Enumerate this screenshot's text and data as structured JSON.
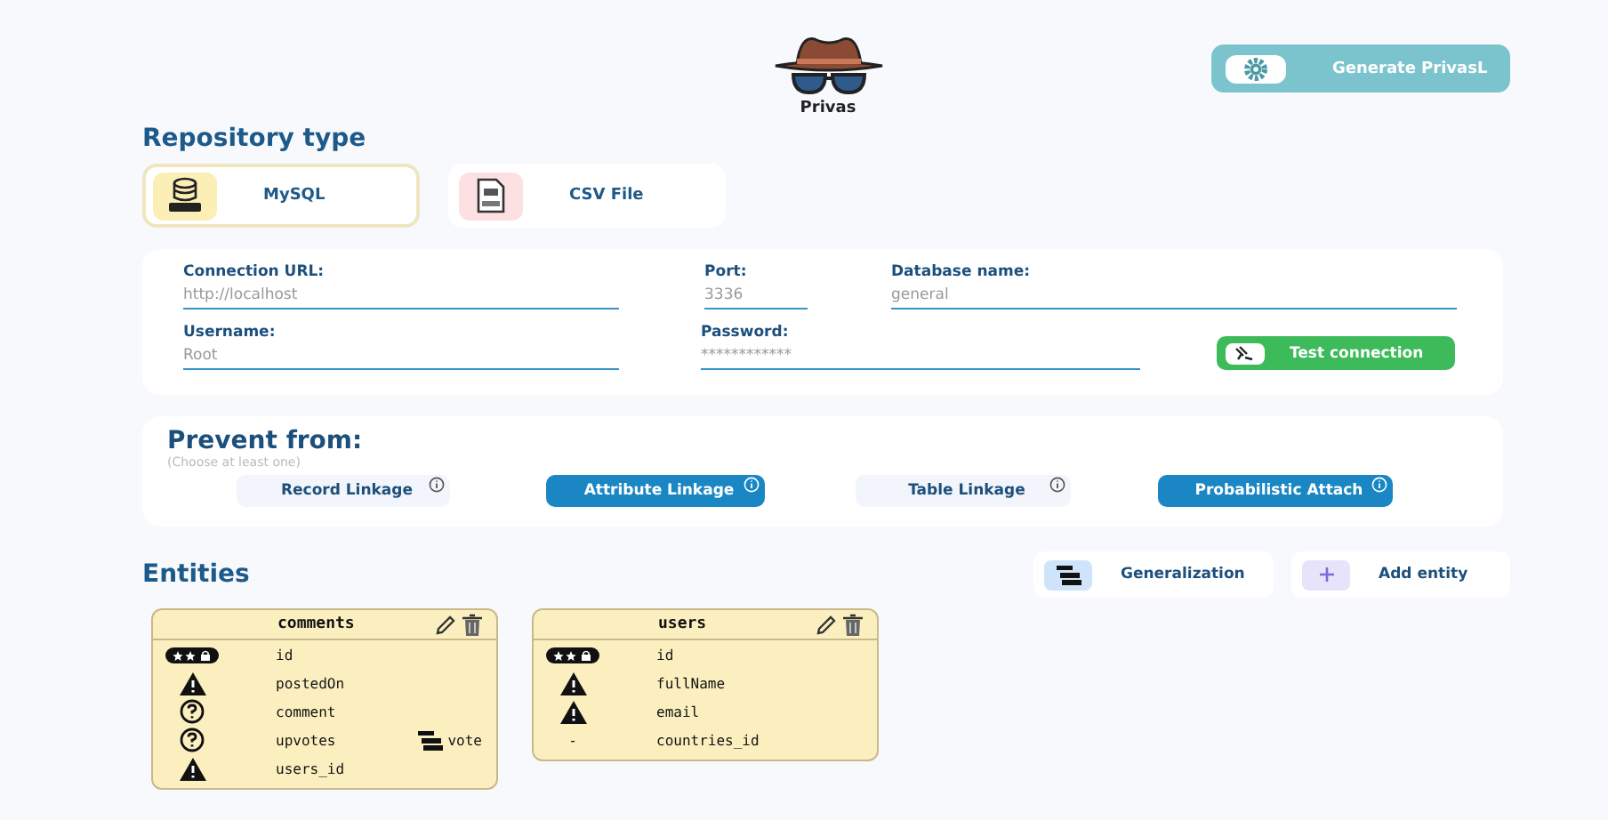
{
  "app": {
    "name": "Privas"
  },
  "generate_button": {
    "label": "Generate PrivasL"
  },
  "repository": {
    "title": "Repository type",
    "options": [
      {
        "label": "MySQL",
        "kind": "mysql",
        "selected": true
      },
      {
        "label": "CSV File",
        "kind": "csv",
        "selected": false
      }
    ]
  },
  "connection": {
    "fields": [
      {
        "label": "Connection URL:",
        "placeholder": "http://localhost",
        "kind": "url"
      },
      {
        "label": "Port:",
        "placeholder": "3336",
        "kind": "port"
      },
      {
        "label": "Database name:",
        "placeholder": "general",
        "kind": "db"
      },
      {
        "label": "Username:",
        "placeholder": "Root",
        "kind": "user"
      },
      {
        "label": "Password:",
        "placeholder": "************",
        "kind": "password"
      }
    ],
    "test_button": {
      "label": "Test connection"
    }
  },
  "prevent": {
    "title": "Prevent from:",
    "hint": "(Choose at least one)",
    "options": [
      {
        "label": "Record Linkage",
        "selected": false
      },
      {
        "label": "Attribute Linkage",
        "selected": true
      },
      {
        "label": "Table Linkage",
        "selected": false
      },
      {
        "label": "Probabilistic Attach",
        "selected": true
      }
    ]
  },
  "entities": {
    "title": "Entities",
    "actions": [
      {
        "label": "Generalization",
        "kind": "generalization"
      },
      {
        "label": "Add entity",
        "kind": "add"
      }
    ],
    "tables": [
      {
        "name": "comments",
        "attributes": [
          {
            "name": "id",
            "kind": "key"
          },
          {
            "name": "postedOn",
            "kind": "warning"
          },
          {
            "name": "comment",
            "kind": "question"
          },
          {
            "name": "upvotes",
            "kind": "question",
            "generalization": "vote"
          },
          {
            "name": "users_id",
            "kind": "warning"
          }
        ]
      },
      {
        "name": "users",
        "attributes": [
          {
            "name": "id",
            "kind": "key"
          },
          {
            "name": "fullName",
            "kind": "warning"
          },
          {
            "name": "email",
            "kind": "warning"
          },
          {
            "name": "countries_id",
            "kind": "none",
            "symbol": "-"
          }
        ]
      }
    ]
  }
}
